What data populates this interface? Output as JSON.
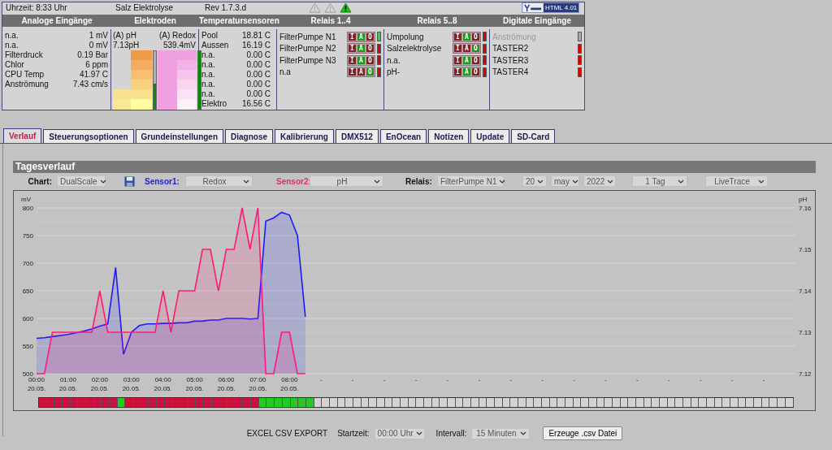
{
  "header": {
    "time": "Uhrzeit: 8:33 Uhr",
    "title": "Salz Elektrolyse",
    "revision": "Rev 1.7.3.d",
    "warnings": [
      {
        "active": false
      },
      {
        "active": false
      },
      {
        "active": true
      }
    ],
    "badge": "HTML 4.01"
  },
  "columns": [
    "Analoge Eingänge",
    "Elektroden",
    "Temperatursensoren",
    "Relais 1..4",
    "Relais 5..8",
    "Digitale Eingänge"
  ],
  "analog": [
    {
      "label": "n.a.",
      "value": "1 mV"
    },
    {
      "label": "n.a.",
      "value": "0 mV"
    },
    {
      "label": "Filterdruck",
      "value": "0.19 Bar"
    },
    {
      "label": "Chlor",
      "value": "6 ppm"
    },
    {
      "label": "CPU Temp",
      "value": "41.97 C"
    },
    {
      "label": "Anströmung",
      "value": "7.43 cm/s"
    }
  ],
  "electrodes": [
    {
      "label": "(A) pH",
      "value": "7.13pH",
      "kind": "ph",
      "level": 0.44
    },
    {
      "label": "(A) Redox",
      "value": "539.4mV",
      "kind": "redox",
      "level": 1
    }
  ],
  "temperatures": [
    {
      "label": "Pool",
      "value": "18.81 C"
    },
    {
      "label": "Aussen",
      "value": "16.19 C"
    },
    {
      "label": "n.a.",
      "value": "0.00 C"
    },
    {
      "label": "n.a.",
      "value": "0.00 C"
    },
    {
      "label": "n.a.",
      "value": "0.00 C"
    },
    {
      "label": "n.a.",
      "value": "0.00 C"
    },
    {
      "label": "n.a.",
      "value": "0.00 C"
    },
    {
      "label": "Elektro",
      "value": "16.56 C"
    }
  ],
  "relays": [
    [
      {
        "name": "FilterPumpe N1",
        "on": true,
        "buttons": [
          {
            "label": "I",
            "selected": false
          },
          {
            "label": "A",
            "selected": true
          },
          {
            "label": "O",
            "selected": false
          }
        ]
      },
      {
        "name": "FilterPumpe N2",
        "on": false,
        "buttons": [
          {
            "label": "I",
            "selected": false
          },
          {
            "label": "A",
            "selected": true
          },
          {
            "label": "O",
            "selected": false
          }
        ]
      },
      {
        "name": "FilterPumpe N3",
        "on": false,
        "buttons": [
          {
            "label": "I",
            "selected": false
          },
          {
            "label": "A",
            "selected": true
          },
          {
            "label": "O",
            "selected": false
          }
        ]
      },
      {
        "name": "n.a",
        "on": false,
        "buttons": [
          {
            "label": "I",
            "selected": false
          },
          {
            "label": "A",
            "selected": false
          },
          {
            "label": "O",
            "selected": true
          }
        ]
      }
    ],
    [
      {
        "name": "Umpolung",
        "on": false,
        "buttons": [
          {
            "label": "I",
            "selected": false
          },
          {
            "label": "A",
            "selected": true
          },
          {
            "label": "O",
            "selected": false
          }
        ]
      },
      {
        "name": "Salzelektrolyse",
        "on": false,
        "buttons": [
          {
            "label": "I",
            "selected": false
          },
          {
            "label": "A",
            "selected": false
          },
          {
            "label": "O",
            "selected": true
          }
        ]
      },
      {
        "name": "n.a.",
        "on": false,
        "buttons": [
          {
            "label": "I",
            "selected": false
          },
          {
            "label": "A",
            "selected": true
          },
          {
            "label": "O",
            "selected": false
          }
        ]
      },
      {
        "name": "pH-",
        "on": false,
        "buttons": [
          {
            "label": "I",
            "selected": false
          },
          {
            "label": "A",
            "selected": true
          },
          {
            "label": "O",
            "selected": false
          }
        ]
      }
    ]
  ],
  "digital": [
    {
      "name": "Anströmung",
      "disabled": true,
      "on": false
    },
    {
      "name": "TASTER2",
      "disabled": false,
      "on": false
    },
    {
      "name": "TASTER3",
      "disabled": false,
      "on": false
    },
    {
      "name": "TASTER4",
      "disabled": false,
      "on": false
    }
  ],
  "tabs": [
    {
      "label": "Verlauf",
      "selected": true
    },
    {
      "label": "Steuerungsoptionen",
      "selected": false
    },
    {
      "label": "Grundeinstellungen",
      "selected": false
    },
    {
      "label": "Diagnose",
      "selected": false
    },
    {
      "label": "Kalibrierung",
      "selected": false
    },
    {
      "label": "DMX512",
      "selected": false
    },
    {
      "label": "EnOcean",
      "selected": false
    },
    {
      "label": "Notizen",
      "selected": false
    },
    {
      "label": "Update",
      "selected": false
    },
    {
      "label": "SD-Card",
      "selected": false
    }
  ],
  "panel": {
    "title": "Tagesverlauf",
    "controls": [
      {
        "kind": "label",
        "text": "Chart:"
      },
      {
        "kind": "dropdown",
        "value": "DualScale"
      },
      {
        "kind": "save"
      },
      {
        "kind": "label",
        "text": "Sensor1:",
        "color": "#2020e0"
      },
      {
        "kind": "dropdown",
        "value": "Redox"
      },
      {
        "kind": "label",
        "text": "Sensor2:",
        "color": "#e0306a"
      },
      {
        "kind": "dropdown",
        "value": "pH"
      },
      {
        "kind": "label",
        "text": "Relais:"
      },
      {
        "kind": "dropdown",
        "value": "FilterPumpe N1"
      },
      {
        "kind": "dropdown",
        "value": "20"
      },
      {
        "kind": "dropdown",
        "value": "may"
      },
      {
        "kind": "dropdown",
        "value": "2022"
      },
      {
        "kind": "dropdown",
        "value": "1 Tag"
      },
      {
        "kind": "dropdown",
        "value": "LiveTrace"
      }
    ],
    "chart_data": {
      "type": "area",
      "grid": true,
      "ylabel": "mV",
      "y2label": "pH",
      "ylim": [
        500,
        800
      ],
      "y2lim": [
        7.12,
        7.16
      ],
      "yticks": [
        500,
        550,
        600,
        650,
        700,
        750,
        800
      ],
      "y2ticks": [
        7.12,
        7.13,
        7.14,
        7.15,
        7.16
      ],
      "categories": [
        "00:00 20.05.",
        null,
        null,
        null,
        "01:00 20.05.",
        null,
        null,
        null,
        "02:00 20.05.",
        null,
        null,
        null,
        "03:00 20.05.",
        null,
        null,
        null,
        "04:00 20.05.",
        null,
        null,
        null,
        "05:00 20.05.",
        null,
        null,
        null,
        "06:00 20.05.",
        null,
        null,
        null,
        "07:00 20.05.",
        null,
        null,
        null,
        "08:00 20.05.",
        null,
        null,
        null,
        "-",
        null,
        null,
        null,
        "-",
        null,
        null,
        null,
        "-",
        null,
        null,
        null,
        "-",
        null,
        null,
        null,
        "-",
        null,
        null,
        null,
        "-",
        null,
        null,
        null,
        "-",
        null,
        null,
        null,
        "-",
        null,
        null,
        null,
        "-",
        null,
        null,
        null,
        "-",
        null,
        null,
        null,
        "-",
        null,
        null,
        null,
        "-",
        null,
        null,
        null,
        "-",
        null,
        null,
        null,
        "-",
        null,
        null,
        null,
        "-",
        null,
        null,
        null
      ],
      "series": [
        {
          "color": "#1a1aff",
          "values": [
            564,
            565,
            567,
            569,
            571,
            574,
            577,
            581,
            586,
            590,
            692,
            535,
            575,
            587,
            590,
            590,
            591,
            591,
            592,
            592,
            595,
            595,
            597,
            597,
            600,
            600,
            600,
            599,
            600,
            776,
            782,
            792,
            787,
            750,
            603,
            null,
            null,
            null,
            null,
            null,
            null,
            null,
            null,
            null,
            null,
            null,
            null,
            null,
            null,
            null,
            null,
            null,
            null,
            null,
            null,
            null,
            null,
            null,
            null,
            null,
            null,
            null,
            null,
            null,
            null,
            null,
            null,
            null,
            null,
            null,
            null,
            null,
            null,
            null,
            null,
            null,
            null,
            null,
            null,
            null,
            null,
            null,
            null,
            null,
            null,
            null,
            null,
            null,
            null,
            null,
            null,
            null,
            null,
            null,
            null,
            null
          ]
        },
        {
          "color": "#ff1a75",
          "axis": "y2",
          "values": [
            7.12,
            7.12,
            7.13,
            7.13,
            7.13,
            7.13,
            7.13,
            7.13,
            7.14,
            7.13,
            7.13,
            7.13,
            7.13,
            7.13,
            7.13,
            7.13,
            7.14,
            7.13,
            7.14,
            7.14,
            7.14,
            7.15,
            7.15,
            7.14,
            7.15,
            7.15,
            7.16,
            7.15,
            7.16,
            7.12,
            7.12,
            7.13,
            7.13,
            7.12,
            7.12,
            null,
            null,
            null,
            null,
            null,
            null,
            null,
            null,
            null,
            null,
            null,
            null,
            null,
            null,
            null,
            null,
            null,
            null,
            null,
            null,
            null,
            null,
            null,
            null,
            null,
            null,
            null,
            null,
            null,
            null,
            null,
            null,
            null,
            null,
            null,
            null,
            null,
            null,
            null,
            null,
            null,
            null,
            null,
            null,
            null,
            null,
            null,
            null,
            null,
            null,
            null,
            null,
            null,
            null,
            null,
            null,
            null,
            null,
            null,
            null,
            null
          ]
        }
      ]
    },
    "slots": [
      {
        "active": true,
        "on": false
      },
      {
        "active": true,
        "on": false
      },
      {
        "active": true,
        "on": false
      },
      {
        "active": true,
        "on": false
      },
      {
        "active": true,
        "on": false
      },
      {
        "active": true,
        "on": false
      },
      {
        "active": true,
        "on": false
      },
      {
        "active": true,
        "on": false
      },
      {
        "active": true,
        "on": false
      },
      {
        "active": true,
        "on": false
      },
      {
        "active": true,
        "on": true
      },
      {
        "active": true,
        "on": false
      },
      {
        "active": true,
        "on": false
      },
      {
        "active": true,
        "on": false
      },
      {
        "active": true,
        "on": false
      },
      {
        "active": true,
        "on": false
      },
      {
        "active": true,
        "on": false
      },
      {
        "active": true,
        "on": false
      },
      {
        "active": true,
        "on": false
      },
      {
        "active": true,
        "on": false
      },
      {
        "active": true,
        "on": false
      },
      {
        "active": true,
        "on": false
      },
      {
        "active": true,
        "on": false
      },
      {
        "active": true,
        "on": false
      },
      {
        "active": true,
        "on": false
      },
      {
        "active": true,
        "on": false
      },
      {
        "active": true,
        "on": false
      },
      {
        "active": true,
        "on": false
      },
      {
        "active": true,
        "on": true
      },
      {
        "active": true,
        "on": true
      },
      {
        "active": true,
        "on": true
      },
      {
        "active": true,
        "on": true
      },
      {
        "active": true,
        "on": true
      },
      {
        "active": true,
        "on": true
      },
      {
        "active": true,
        "on": true
      },
      {
        "active": false,
        "on": false
      },
      {
        "active": false,
        "on": false
      },
      {
        "active": false,
        "on": false
      },
      {
        "active": false,
        "on": false
      },
      {
        "active": false,
        "on": false
      },
      {
        "active": false,
        "on": false
      },
      {
        "active": false,
        "on": false
      },
      {
        "active": false,
        "on": false
      },
      {
        "active": false,
        "on": false
      },
      {
        "active": false,
        "on": false
      },
      {
        "active": false,
        "on": false
      },
      {
        "active": false,
        "on": false
      },
      {
        "active": false,
        "on": false
      },
      {
        "active": false,
        "on": false
      },
      {
        "active": false,
        "on": false
      },
      {
        "active": false,
        "on": false
      },
      {
        "active": false,
        "on": false
      },
      {
        "active": false,
        "on": false
      },
      {
        "active": false,
        "on": false
      },
      {
        "active": false,
        "on": false
      },
      {
        "active": false,
        "on": false
      },
      {
        "active": false,
        "on": false
      },
      {
        "active": false,
        "on": false
      },
      {
        "active": false,
        "on": false
      },
      {
        "active": false,
        "on": false
      },
      {
        "active": false,
        "on": false
      },
      {
        "active": false,
        "on": false
      },
      {
        "active": false,
        "on": false
      },
      {
        "active": false,
        "on": false
      },
      {
        "active": false,
        "on": false
      },
      {
        "active": false,
        "on": false
      },
      {
        "active": false,
        "on": false
      },
      {
        "active": false,
        "on": false
      },
      {
        "active": false,
        "on": false
      },
      {
        "active": false,
        "on": false
      },
      {
        "active": false,
        "on": false
      },
      {
        "active": false,
        "on": false
      },
      {
        "active": false,
        "on": false
      },
      {
        "active": false,
        "on": false
      },
      {
        "active": false,
        "on": false
      },
      {
        "active": false,
        "on": false
      },
      {
        "active": false,
        "on": false
      },
      {
        "active": false,
        "on": false
      },
      {
        "active": false,
        "on": false
      },
      {
        "active": false,
        "on": false
      },
      {
        "active": false,
        "on": false
      },
      {
        "active": false,
        "on": false
      },
      {
        "active": false,
        "on": false
      },
      {
        "active": false,
        "on": false
      },
      {
        "active": false,
        "on": false
      },
      {
        "active": false,
        "on": false
      },
      {
        "active": false,
        "on": false
      },
      {
        "active": false,
        "on": false
      },
      {
        "active": false,
        "on": false
      },
      {
        "active": false,
        "on": false
      },
      {
        "active": false,
        "on": false
      },
      {
        "active": false,
        "on": false
      },
      {
        "active": false,
        "on": false
      },
      {
        "active": false,
        "on": false
      },
      {
        "active": false,
        "on": false
      },
      {
        "active": false,
        "on": false
      }
    ]
  },
  "export": {
    "title": "EXCEL CSV EXPORT",
    "start_label": "Startzeit:",
    "start_value": "00:00 Uhr",
    "interval_label": "Intervall:",
    "interval_value": "15 Minuten",
    "button": "Erzeuge .csv Datei"
  }
}
